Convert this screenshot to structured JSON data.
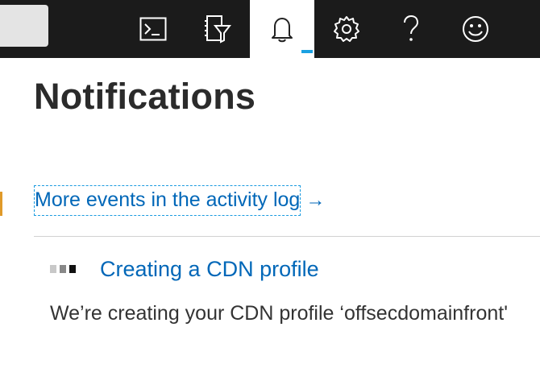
{
  "topbar": {
    "buttons": [
      {
        "icon": "cloud-shell-icon"
      },
      {
        "icon": "directory-filter-icon"
      },
      {
        "icon": "notifications-bell-icon",
        "active": true
      },
      {
        "icon": "settings-gear-icon"
      },
      {
        "icon": "help-question-icon"
      },
      {
        "icon": "feedback-smiley-icon"
      }
    ],
    "accent_color": "#1ba1e2",
    "background_color": "#1b1b1b"
  },
  "panel": {
    "title": "Notifications",
    "activity_link": {
      "label": "More events in the activity log",
      "arrow": "→"
    },
    "notifications": [
      {
        "title": "Creating a CDN profile",
        "body": "We’re creating your CDN profile ‘offsecdomainfront'",
        "status": "in-progress"
      }
    ]
  },
  "colors": {
    "link": "#0067b8",
    "title_text": "#2b2b2b",
    "body_text": "#333333"
  }
}
